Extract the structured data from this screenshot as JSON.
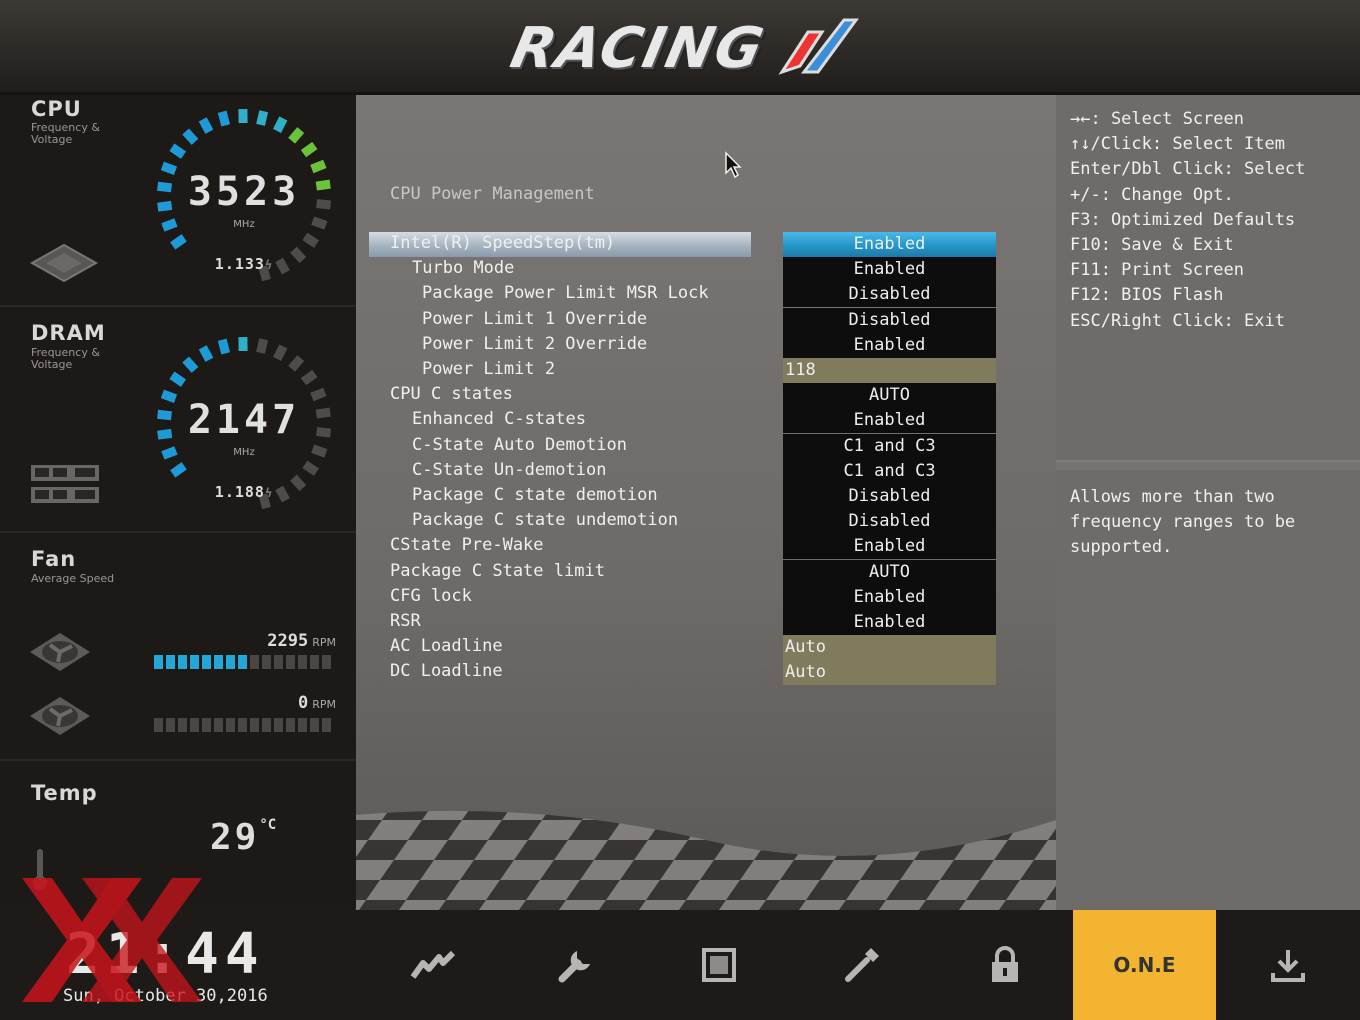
{
  "brand": {
    "logo_text": "RACING"
  },
  "sidebar": {
    "cpu": {
      "title": "CPU",
      "subtitle": "Frequency & Voltage",
      "frequency": "3523",
      "unit": "MHz",
      "voltage": "1.133"
    },
    "dram": {
      "title": "DRAM",
      "subtitle": "Frequency & Voltage",
      "frequency": "2147",
      "unit": "MHz",
      "voltage": "1.188"
    },
    "fan": {
      "title": "Fan",
      "subtitle": "Average Speed",
      "fans": [
        {
          "rpm": "2295",
          "unit": "RPM",
          "level": 0.53
        },
        {
          "rpm": "0",
          "unit": "RPM",
          "level": 0
        }
      ]
    },
    "temp": {
      "title": "Temp",
      "value": "29",
      "unit": "°C"
    }
  },
  "main": {
    "section_title": "CPU Power Management",
    "rows": [
      {
        "label": "Intel(R) SpeedStep(tm)",
        "value": "Enabled",
        "indent": 0,
        "selected": true,
        "edit": false
      },
      {
        "label": "Turbo Mode",
        "value": "Enabled",
        "indent": 1,
        "selected": false,
        "edit": false
      },
      {
        "label": "Package Power Limit MSR Lock",
        "value": "Disabled",
        "indent": 2,
        "selected": false,
        "edit": false
      },
      {
        "label": "Power Limit 1 Override",
        "value": "Disabled",
        "indent": 2,
        "selected": false,
        "edit": false
      },
      {
        "label": "Power Limit 2 Override",
        "value": "Enabled",
        "indent": 2,
        "selected": false,
        "edit": false
      },
      {
        "label": "Power Limit 2",
        "value": "118",
        "indent": 2,
        "selected": false,
        "edit": true
      },
      {
        "label": "CPU C states",
        "value": "AUTO",
        "indent": 0,
        "selected": false,
        "edit": false
      },
      {
        "label": "Enhanced C-states",
        "value": "Enabled",
        "indent": 1,
        "selected": false,
        "edit": false
      },
      {
        "label": "C-State Auto Demotion",
        "value": "C1 and C3",
        "indent": 1,
        "selected": false,
        "edit": false
      },
      {
        "label": "C-State Un-demotion",
        "value": "C1 and C3",
        "indent": 1,
        "selected": false,
        "edit": false
      },
      {
        "label": "Package C state demotion",
        "value": "Disabled",
        "indent": 1,
        "selected": false,
        "edit": false
      },
      {
        "label": "Package C state undemotion",
        "value": "Disabled",
        "indent": 1,
        "selected": false,
        "edit": false
      },
      {
        "label": "CState Pre-Wake",
        "value": "Enabled",
        "indent": 0,
        "selected": false,
        "edit": false
      },
      {
        "label": "Package C State limit",
        "value": "AUTO",
        "indent": 0,
        "selected": false,
        "edit": false
      },
      {
        "label": "CFG lock",
        "value": "Enabled",
        "indent": 0,
        "selected": false,
        "edit": false
      },
      {
        "label": "RSR",
        "value": "Enabled",
        "indent": 0,
        "selected": false,
        "edit": false
      },
      {
        "label": "AC Loadline",
        "value": "Auto",
        "indent": 0,
        "selected": false,
        "edit": true
      },
      {
        "label": "DC Loadline",
        "value": "Auto",
        "indent": 0,
        "selected": false,
        "edit": true
      }
    ]
  },
  "help": {
    "keys": [
      "→←: Select Screen",
      "↑↓/Click: Select Item",
      "Enter/Dbl Click: Select",
      "+/-: Change Opt.",
      "F3: Optimized Defaults",
      "F10: Save & Exit",
      "F11: Print Screen",
      "F12: BIOS Flash",
      "ESC/Right Click: Exit"
    ],
    "description": "Allows more than two frequency ranges to be supported."
  },
  "footer": {
    "time": "21:44",
    "date": "Sun, October  30,2016",
    "nav": [
      {
        "icon": "overclock-icon"
      },
      {
        "icon": "wrench-icon"
      },
      {
        "icon": "chipset-icon"
      },
      {
        "icon": "pen-icon"
      },
      {
        "icon": "lock-icon"
      },
      {
        "label": "O.N.E",
        "active": true
      },
      {
        "icon": "download-icon"
      }
    ]
  },
  "colors": {
    "accent": "#23a6d8",
    "active_tab": "#f2b431",
    "edit_field": "#7f7b5c"
  }
}
